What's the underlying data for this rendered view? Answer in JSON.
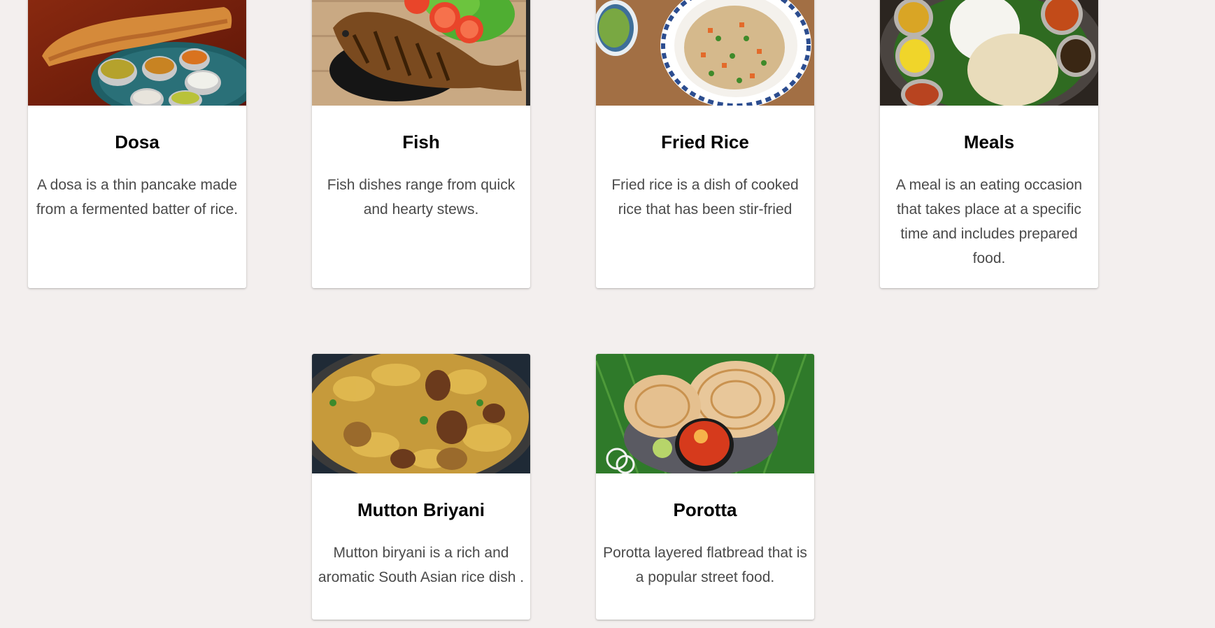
{
  "cards": [
    {
      "id": "dosa",
      "title": "Dosa",
      "description": "A dosa is a thin pancake made from a fermented batter of rice.",
      "image": "dosa-photo"
    },
    {
      "id": "fish",
      "title": "Fish",
      "description": "Fish dishes range from quick and hearty stews.",
      "image": "fish-photo"
    },
    {
      "id": "fried-rice",
      "title": "Fried Rice",
      "description": "Fried rice is a dish of cooked rice that has been stir-fried",
      "image": "fried-rice-photo"
    },
    {
      "id": "meals",
      "title": "Meals",
      "description": "A meal is an eating occasion that takes place at a specific time and includes prepared food.",
      "image": "meals-photo"
    },
    {
      "id": "mutton-briyani",
      "title": "Mutton Briyani",
      "description": "Mutton biryani is a rich and aromatic South Asian rice dish .",
      "image": "mutton-briyani-photo"
    },
    {
      "id": "porotta",
      "title": "Porotta",
      "description": "Porotta layered flatbread that is a popular street food.",
      "image": "porotta-photo"
    }
  ],
  "colors": {
    "page_background": "#f3efee",
    "card_background": "#ffffff",
    "title_text": "#000000",
    "description_text": "#4a4a4a"
  }
}
